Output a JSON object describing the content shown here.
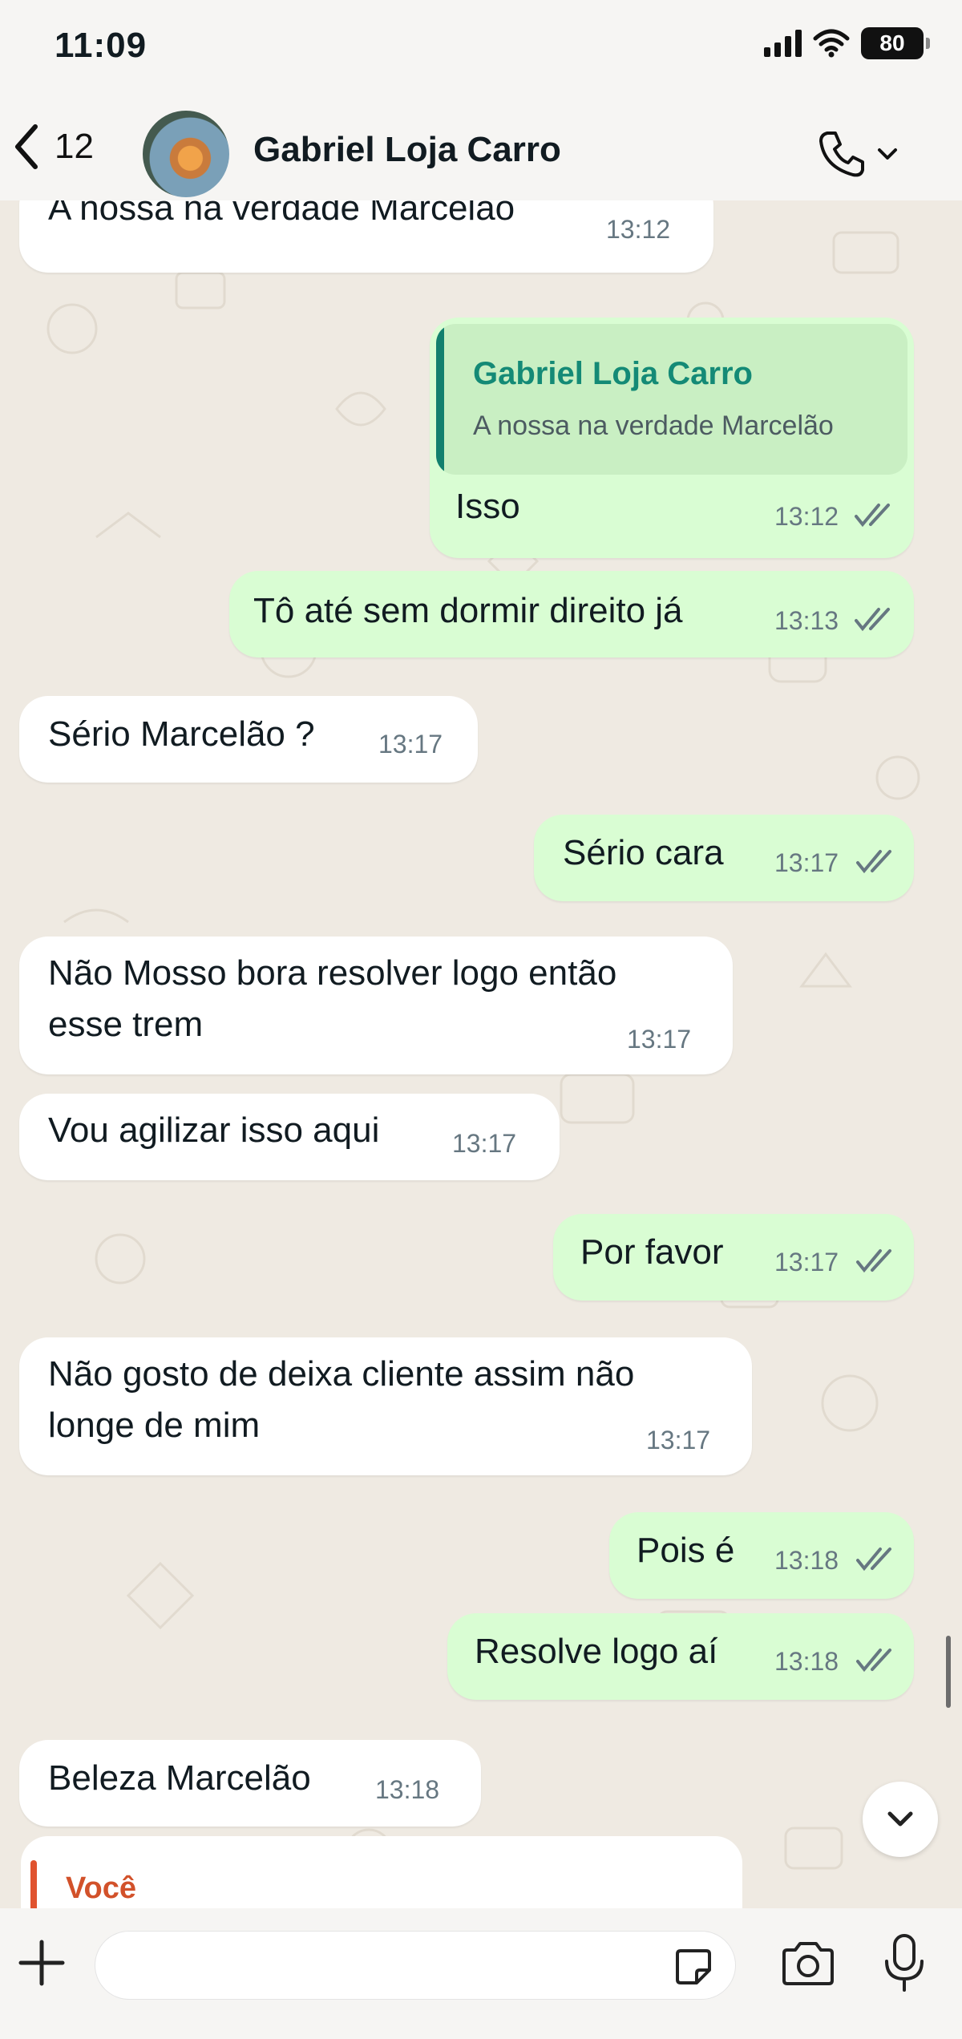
{
  "status_bar": {
    "time": "11:09",
    "battery": "80"
  },
  "header": {
    "back_count": "12",
    "contact_name": "Gabriel Loja Carro"
  },
  "messages": [
    {
      "dir": "in",
      "text": "A nossa na verdade Marcelão",
      "time": "13:12"
    },
    {
      "dir": "out",
      "reply_author": "Gabriel Loja Carro",
      "reply_text": "A nossa na verdade Marcelão",
      "text": "Isso",
      "time": "13:12"
    },
    {
      "dir": "out",
      "text": "Tô até sem dormir direito já",
      "time": "13:13"
    },
    {
      "dir": "in",
      "text": "Sério Marcelão ?",
      "time": "13:17"
    },
    {
      "dir": "out",
      "text": "Sério cara",
      "time": "13:17"
    },
    {
      "dir": "in",
      "text_line1": "Não Mosso bora resolver logo então",
      "text_line2": "esse trem",
      "time": "13:17"
    },
    {
      "dir": "in",
      "text": "Vou agilizar isso aqui",
      "time": "13:17"
    },
    {
      "dir": "out",
      "text": "Por favor",
      "time": "13:17"
    },
    {
      "dir": "in",
      "text_line1": "Não gosto de deixa cliente assim não",
      "text_line2": "longe de mim",
      "time": "13:17"
    },
    {
      "dir": "out",
      "text": "Pois é",
      "time": "13:18"
    },
    {
      "dir": "out",
      "text": "Resolve logo aí",
      "time": "13:18"
    },
    {
      "dir": "in",
      "text": "Beleza Marcelão",
      "time": "13:18"
    }
  ],
  "partial_message": {
    "quote_author": "Você"
  },
  "composer": {
    "placeholder": ""
  },
  "colors": {
    "incoming": "#ffffff",
    "outgoing": "#d9fdd3",
    "accent": "#12806e",
    "quote_accent": "#d2512a"
  },
  "icons": [
    "back-chevron-icon",
    "phone-icon",
    "chevron-down-icon",
    "plus-icon",
    "sticker-icon",
    "camera-icon",
    "microphone-icon"
  ]
}
